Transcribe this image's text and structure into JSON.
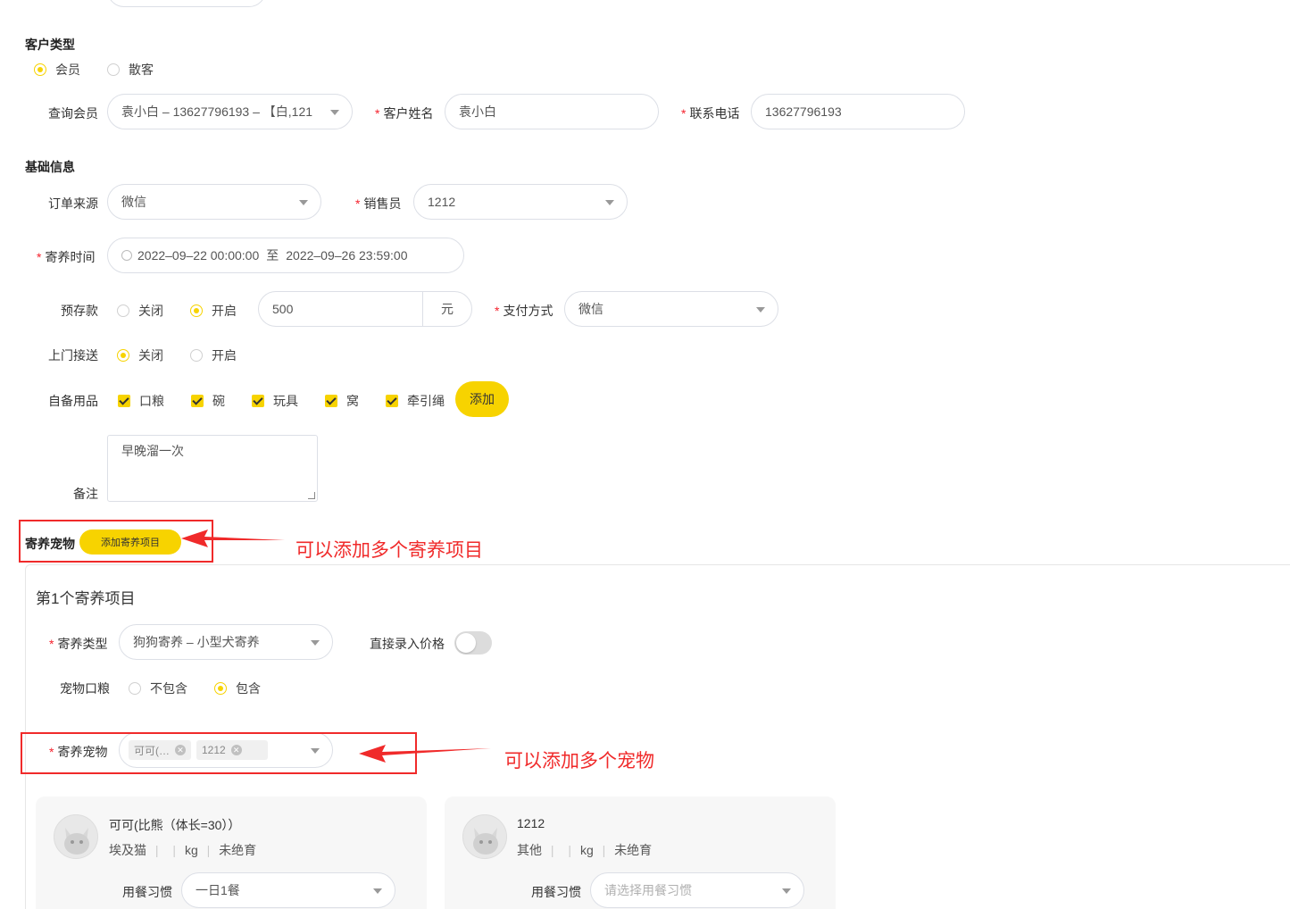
{
  "customer_type": {
    "title": "客户类型",
    "options": [
      "会员",
      "散客"
    ],
    "selected": "会员"
  },
  "member_search": {
    "label": "查询会员",
    "value": "袁小白 – 13627796193 – 【白,121"
  },
  "customer_name": {
    "label": "客户姓名",
    "value": "袁小白"
  },
  "phone": {
    "label": "联系电话",
    "value": "13627796193"
  },
  "basic_info": {
    "title": "基础信息",
    "order_source": {
      "label": "订单来源",
      "value": "微信"
    },
    "salesperson": {
      "label": "销售员",
      "value": "1212"
    },
    "board_time": {
      "label": "寄养时间",
      "start": "2022–09–22 00:00:00",
      "sep": "至",
      "end": "2022–09–26 23:59:00"
    },
    "deposit": {
      "label": "预存款",
      "off": "关闭",
      "on": "开启",
      "amount": "500",
      "unit": "元"
    },
    "payment": {
      "label": "支付方式",
      "value": "微信"
    },
    "pickup": {
      "label": "上门接送",
      "off": "关闭",
      "on": "开启"
    },
    "supplies": {
      "label": "自备用品",
      "items": [
        "口粮",
        "碗",
        "玩具",
        "窝",
        "牵引绳"
      ],
      "add_label": "添加"
    },
    "note": {
      "label": "备注",
      "value": "早晚溜一次"
    }
  },
  "boarding_pets": {
    "title": "寄养宠物",
    "add_item_label": "添加寄养项目",
    "annotation_items": "可以添加多个寄养项目",
    "annotation_pets": "可以添加多个宠物"
  },
  "item1": {
    "title": "第1个寄养项目",
    "type": {
      "label": "寄养类型",
      "value": "狗狗寄养 – 小型犬寄养"
    },
    "direct_price": {
      "label": "直接录入价格"
    },
    "food": {
      "label": "宠物口粮",
      "off": "不包含",
      "on": "包含"
    },
    "pets": {
      "label": "寄养宠物",
      "tags": [
        "可可(…",
        "1212"
      ]
    }
  },
  "pet_cards": [
    {
      "name": "可可(比熊（体长=30））",
      "breed": "埃及猫",
      "sep": "|",
      "weight_unit": "kg",
      "status": "未绝育",
      "meal_label": "用餐习惯",
      "meal_value": "一日1餐"
    },
    {
      "name": "1212",
      "breed": "其他",
      "sep": "|",
      "weight_unit": "kg",
      "status": "未绝育",
      "meal_label": "用餐习惯",
      "meal_placeholder": "请选择用餐习惯"
    }
  ],
  "colors": {
    "accent": "#f7d300",
    "annotation": "#f02a2a"
  }
}
